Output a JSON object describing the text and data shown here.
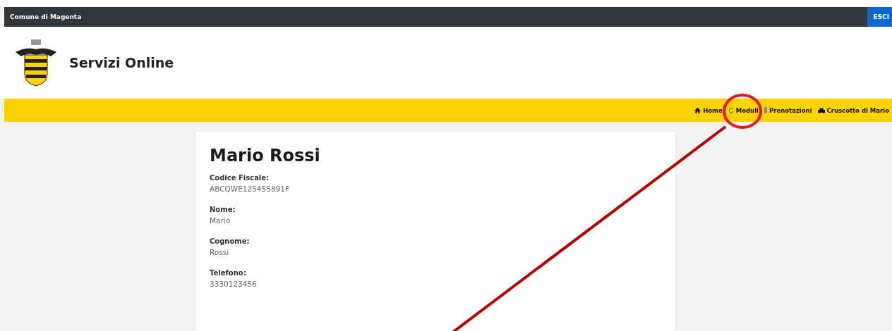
{
  "top_bar": {
    "title": "Comune di Magenta",
    "button": "ESCI"
  },
  "header": {
    "title": "Servizi Online"
  },
  "nav": [
    {
      "label": "Home",
      "kind": "home"
    },
    {
      "label": "Moduli",
      "kind": "refresh"
    },
    {
      "label": "Prenotazioni",
      "kind": "bar"
    },
    {
      "label": "Cruscotto di Mario",
      "kind": "car"
    }
  ],
  "profile": {
    "name": "Mario Rossi",
    "fields": [
      {
        "label": "Codice Fiscale:",
        "value": "ABCQWE125455891F"
      },
      {
        "label": "Nome:",
        "value": "Mario"
      },
      {
        "label": "Cognome:",
        "value": "Rossi"
      },
      {
        "label": "Telefono:",
        "value": "3330123456"
      }
    ]
  }
}
